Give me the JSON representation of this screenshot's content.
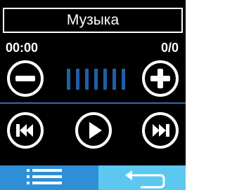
{
  "header": {
    "title": "Музыка"
  },
  "status": {
    "time": "00:00",
    "track_count": "0/0"
  },
  "colors": {
    "accent_blue": "#2f6fae",
    "bar_blue": "#1f5fa8",
    "bottom_left_bg": "#2f8fd6",
    "bottom_right_bg": "#5cc8f0",
    "foreground": "#ffffff",
    "background": "#000000"
  },
  "volume": {
    "level_bars": 7
  },
  "icons": {
    "volume_down": "minus-circle-icon",
    "volume_up": "plus-circle-icon",
    "previous": "skip-previous-icon",
    "play": "play-icon",
    "next": "skip-next-icon",
    "playlist": "list-icon",
    "back": "return-arrow-icon"
  }
}
